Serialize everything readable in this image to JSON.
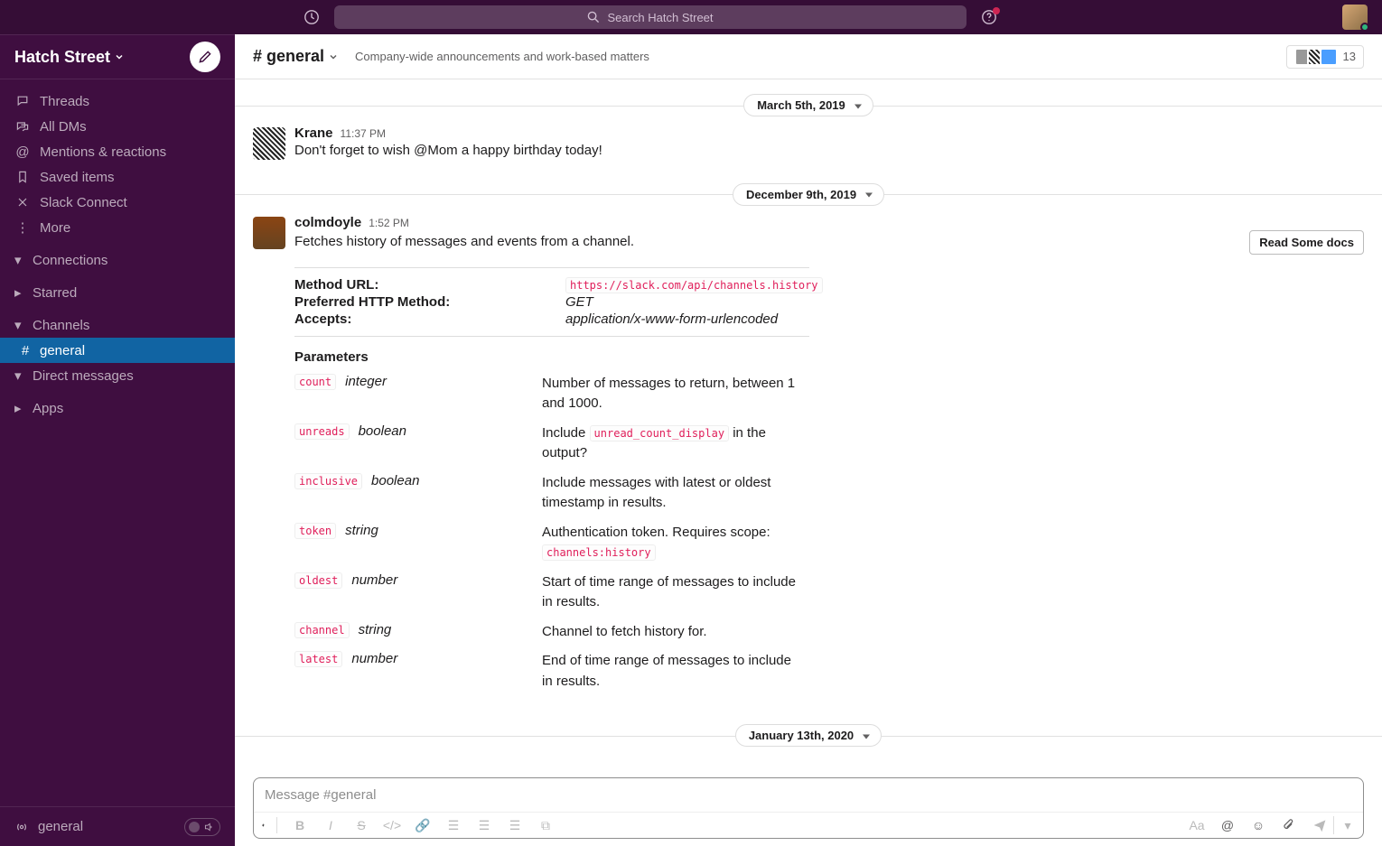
{
  "search": {
    "placeholder": "Search Hatch Street"
  },
  "workspace": {
    "name": "Hatch Street"
  },
  "sidebar": {
    "items": [
      {
        "label": "Threads"
      },
      {
        "label": "All DMs"
      },
      {
        "label": "Mentions & reactions"
      },
      {
        "label": "Saved items"
      },
      {
        "label": "Slack Connect"
      },
      {
        "label": "More"
      }
    ],
    "sections": {
      "connections": "Connections",
      "starred": "Starred",
      "channels": "Channels",
      "dms": "Direct messages",
      "apps": "Apps"
    },
    "channel_item": "general"
  },
  "footer": {
    "channel": "general"
  },
  "channel": {
    "name": "# general",
    "topic": "Company-wide announcements and work-based matters",
    "member_count": "13"
  },
  "dividers": {
    "d1": "March 5th, 2019",
    "d2": "December 9th, 2019",
    "d3": "January 13th, 2020"
  },
  "messages": {
    "m1": {
      "author": "Krane",
      "time": "11:37 PM",
      "text": "Don't forget to wish @Mom a happy birthday today!"
    },
    "m2": {
      "author": "colmdoyle",
      "time": "1:52 PM",
      "text": "Fetches history of messages and events from a channel.",
      "button": "Read Some docs",
      "method_url_label": "Method URL:",
      "method_url_value": "https://slack.com/api/channels.history",
      "http_label": "Preferred HTTP Method:",
      "http_value": "GET",
      "accepts_label": "Accepts:",
      "accepts_value": "application/x-www-form-urlencoded",
      "params_title": "Parameters",
      "params": [
        {
          "name": "count",
          "type": "integer",
          "desc_pre": "Number of messages to return, between 1 and 1000.",
          "desc_post": ""
        },
        {
          "name": "unreads",
          "type": "boolean",
          "desc_pre": "Include ",
          "code": "unread_count_display",
          "desc_post": " in the output?"
        },
        {
          "name": "inclusive",
          "type": "boolean",
          "desc_pre": "Include messages with latest or oldest timestamp in results.",
          "desc_post": ""
        },
        {
          "name": "token",
          "type": "string",
          "desc_pre": "Authentication token. Requires scope: ",
          "code": "channels:history",
          "desc_post": ""
        },
        {
          "name": "oldest",
          "type": "number",
          "desc_pre": "Start of time range of messages to include in results.",
          "desc_post": ""
        },
        {
          "name": "channel",
          "type": "string",
          "desc_pre": "Channel to fetch history for.",
          "desc_post": ""
        },
        {
          "name": "latest",
          "type": "number",
          "desc_pre": "End of time range of messages to include in results.",
          "desc_post": ""
        }
      ]
    }
  },
  "composer": {
    "placeholder": "Message #general"
  }
}
